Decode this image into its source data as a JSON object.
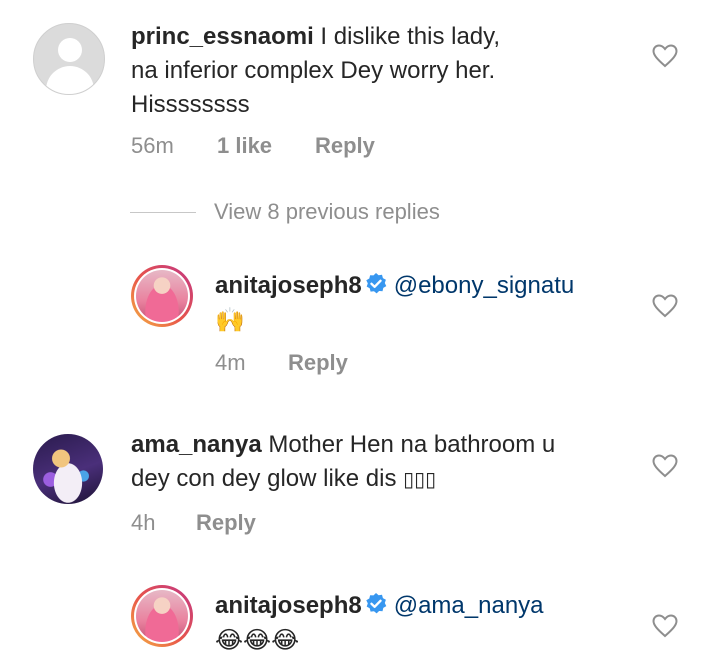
{
  "comments": [
    {
      "username": "princ_essnaomi",
      "text": " I dislike this lady, na inferior complex Dey worry her. Hissssssss",
      "line1": " I dislike this lady,",
      "line2": "na inferior complex Dey worry her.",
      "line3": "Hissssssss",
      "time": "56m",
      "likes": "1 like",
      "reply_label": "Reply"
    },
    {
      "username": "anitajoseph8",
      "mention": "@ebony_signatu",
      "text": "🙌",
      "time": "4m",
      "reply_label": "Reply"
    },
    {
      "username": "ama_nanya",
      "line1": " Mother Hen na bathroom u",
      "line2": "dey con dey glow like dis ",
      "garbled": "▯▯▯",
      "time": "4h",
      "reply_label": "Reply"
    },
    {
      "username": "anitajoseph8",
      "mention": "@ama_nanya",
      "text": "😂😂😂",
      "time": "",
      "reply_label": ""
    }
  ],
  "view_replies": "View 8 previous replies",
  "colors": {
    "verified": "#3897f0",
    "mention": "#00376b",
    "meta": "#8e8e8e"
  },
  "icons": {
    "like": "heart-outline-icon",
    "verified": "verified-badge-icon"
  }
}
